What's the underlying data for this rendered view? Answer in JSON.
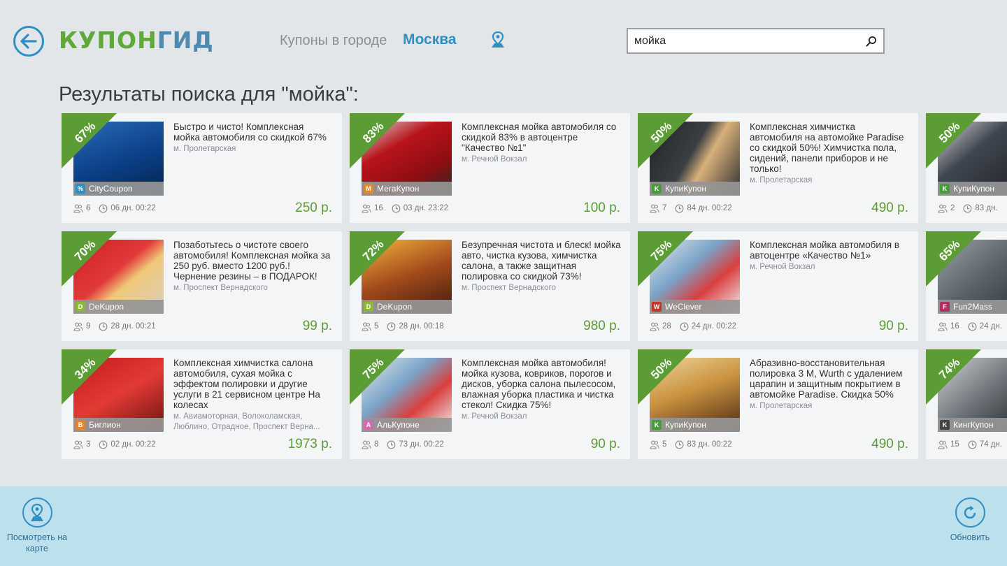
{
  "header": {
    "logo_main": "КУПОН",
    "logo_accent": "ГИД",
    "city_label": "Купоны в городе",
    "city_name": "Москва",
    "search_value": "мойка"
  },
  "results_title": "Результаты поиска для \"мойка\":",
  "cards": [
    {
      "discount": "67%",
      "title": "Быстро и чисто! Комплексная мойка автомобиля со скидкой 67%",
      "metro": "м. Пролетарская",
      "provider": "CityCoupon",
      "provider_color": "#2e8fc4",
      "provider_glyph": "%",
      "buyers": "6",
      "time": "06 дн. 00:22",
      "price": "250 р.",
      "scene": "blue"
    },
    {
      "discount": "83%",
      "title": "Комплексная мойка автомобиля со скидкой 83% в автоцентре \"Качество №1\"",
      "metro": "м. Речной Вокзал",
      "provider": "МегаКупон",
      "provider_color": "#e08a2e",
      "provider_glyph": "М",
      "buyers": "16",
      "time": "03 дн. 23:22",
      "price": "100 р.",
      "scene": "red"
    },
    {
      "discount": "50%",
      "title": "Комплексная химчистка автомобиля на автомойке Paradise со скидкой 50%! Химчистка пола, сидений, панели приборов и не только!",
      "metro": "м. Пролетарская",
      "provider": "КупиКупон",
      "provider_color": "#4a9b3c",
      "provider_glyph": "K",
      "buyers": "7",
      "time": "84 дн. 00:22",
      "price": "490 р.",
      "scene": "girl"
    },
    {
      "discount": "50%",
      "title": "",
      "metro": "",
      "provider": "КупиКупон",
      "provider_color": "#4a9b3c",
      "provider_glyph": "K",
      "buyers": "2",
      "time": "83 дн.",
      "price": "",
      "scene": "dark"
    },
    {
      "discount": "70%",
      "title": "Позаботьтесь о чистоте своего автомобиля! Комплексная мойка за 250 руб. вместо 1200 руб.! Чернение резины – в ПОДАРОК!",
      "metro": "м. Проспект Вернадского",
      "provider": "DeKupon",
      "provider_color": "#8cb83a",
      "provider_glyph": "D",
      "buyers": "9",
      "time": "28 дн. 00:21",
      "price": "99 р.",
      "scene": "sponge"
    },
    {
      "discount": "72%",
      "title": "Безупречная чистота и блеск! мойка авто, чистка кузова, химчистка салона, а также защитная полировка со скидкой 73%!",
      "metro": "м. Проспект Вернадского",
      "provider": "DeKupon",
      "provider_color": "#8cb83a",
      "provider_glyph": "D",
      "buyers": "5",
      "time": "28 дн. 00:18",
      "price": "980 р.",
      "scene": "suv"
    },
    {
      "discount": "75%",
      "title": "Комплексная мойка автомобиля в автоцентре «Качество №1»",
      "metro": "м. Речной Вокзал",
      "provider": "WeClever",
      "provider_color": "#c0392b",
      "provider_glyph": "W",
      "buyers": "28",
      "time": "24 дн. 00:22",
      "price": "90 р.",
      "scene": "wash"
    },
    {
      "discount": "65%",
      "title": "",
      "metro": "",
      "provider": "Fun2Mass",
      "provider_color": "#b03060",
      "provider_glyph": "F",
      "buyers": "16",
      "time": "24 дн.",
      "price": "",
      "scene": "grey"
    },
    {
      "discount": "34%",
      "title": "Комплексная химчистка салона автомобиля, сухая мойка с эффектом полировки и другие услуги в 21 сервисном центре На колесах",
      "metro": "м. Авиамоторная, Волоколамская, Люблино, Отрадное, Проспект Верна...",
      "provider": "Биглион",
      "provider_color": "#e8832a",
      "provider_glyph": "B",
      "buyers": "3",
      "time": "02 дн. 00:22",
      "price": "1973 р.",
      "scene": "polish"
    },
    {
      "discount": "75%",
      "title": "Комплексная мойка автомобиля! мойка кузова, ковриков, порогов и дисков, уборка салона пылесосом, влажная уборка пластика и чистка стекол! Скидка 75%!",
      "metro": "м. Речной Вокзал",
      "provider": "АльКупоне",
      "provider_color": "#d36ab0",
      "provider_glyph": "A",
      "buyers": "8",
      "time": "73 дн. 00:22",
      "price": "90 р.",
      "scene": "wash"
    },
    {
      "discount": "50%",
      "title": "Абразивно-восстановительная полировка 3 M, Wurth с удалением царапин и защитным покрытием в автомойке Paradise. Скидка 50%",
      "metro": "м. Пролетарская",
      "provider": "КупиКупон",
      "provider_color": "#4a9b3c",
      "provider_glyph": "K",
      "buyers": "5",
      "time": "83 дн. 00:22",
      "price": "490 р.",
      "scene": "gold"
    },
    {
      "discount": "74%",
      "title": "",
      "metro": "",
      "provider": "КингКупон",
      "provider_color": "#444444",
      "provider_glyph": "K",
      "buyers": "15",
      "time": "74 дн.",
      "price": "",
      "scene": "grey2"
    }
  ],
  "appbar": {
    "map_label": "Посмотреть на карте",
    "refresh_label": "Обновить"
  }
}
